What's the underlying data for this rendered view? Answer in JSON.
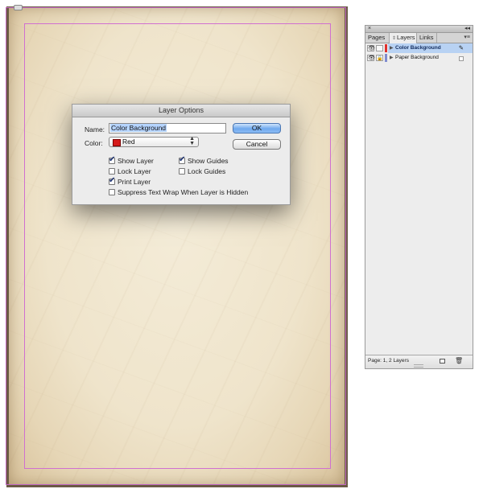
{
  "document": {},
  "dialog": {
    "title": "Layer Options",
    "name_label": "Name:",
    "name_value": "Color Background",
    "color_label": "Color:",
    "color_value": "Red",
    "color_swatch": "#d61a1a",
    "ok_label": "OK",
    "cancel_label": "Cancel",
    "checkboxes": [
      {
        "label": "Show Layer",
        "checked": true
      },
      {
        "label": "Show Guides",
        "checked": true
      },
      {
        "label": "Lock Layer",
        "checked": false
      },
      {
        "label": "Lock Guides",
        "checked": false
      },
      {
        "label": "Print Layer",
        "checked": true
      },
      {
        "label": "Suppress Text Wrap When Layer is Hidden",
        "checked": false
      }
    ]
  },
  "layers_panel": {
    "close_glyph": "×",
    "collapse_glyph": "◂◂",
    "menu_glyph": "▾≡",
    "tabs": [
      {
        "label": "Pages",
        "active": false
      },
      {
        "label": "Layers",
        "active": true
      },
      {
        "label": "Links",
        "active": false
      }
    ],
    "layers": [
      {
        "name": "Color Background",
        "selected": true,
        "locked": false,
        "color": "#e0302c"
      },
      {
        "name": "Paper Background",
        "selected": false,
        "locked": true,
        "color": "#7f8ccf"
      }
    ],
    "status": "Page: 1, 2 Layers"
  }
}
